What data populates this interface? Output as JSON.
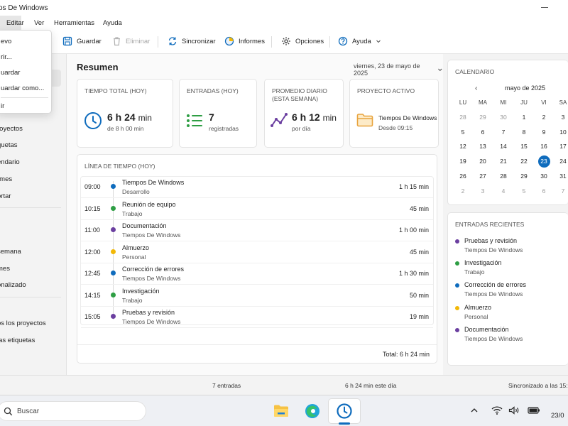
{
  "window": {
    "title": "os De Windows"
  },
  "menubar": {
    "items": [
      "",
      "Editar",
      "Ver",
      "Herramientas",
      "Ayuda"
    ]
  },
  "toolbar": {
    "save": "Guardar",
    "delete": "Eliminar",
    "sync": "Sincronizar",
    "reports": "Informes",
    "options": "Opciones",
    "help": "Ayuda"
  },
  "file_menu": {
    "items": [
      "evo",
      "rir...",
      "uardar",
      "uardar como...",
      "ir"
    ]
  },
  "sidebar": {
    "items": [
      "royectos",
      "quetas",
      "endario",
      "rmes",
      "ortar"
    ],
    "section2": [
      "semana",
      "mes",
      "onalizado"
    ],
    "section3": [
      "os los proyectos",
      "las etiquetas"
    ]
  },
  "main": {
    "heading": "Resumen",
    "date": "viernes, 23 de mayo de 2025",
    "cards": [
      {
        "title": "TIEMPO TOTAL (HOY)",
        "value": "6 h 24",
        "unit": "min",
        "sub": "de 8 h 00 min"
      },
      {
        "title": "ENTRADAS (HOY)",
        "value": "7",
        "unit": "",
        "sub": "registradas"
      },
      {
        "title": "PROMEDIO DIARIO (ESTA SEMANA)",
        "value": "6 h 12",
        "unit": "min",
        "sub": "por día"
      },
      {
        "title": "PROYECTO ACTIVO",
        "value": "Tiempos De Windows",
        "unit": "",
        "sub": "Desde 09:15"
      }
    ],
    "timeline": {
      "title": "LÍNEA DE TIEMPO (HOY)",
      "total": "Total: 6 h 24 min",
      "rows": [
        {
          "time": "09:00",
          "name": "Tiempos De Windows",
          "project": "Desarrollo",
          "duration": "1 h 15 min",
          "color": "#0f6cbd"
        },
        {
          "time": "10:15",
          "name": "Reunión de equipo",
          "project": "Trabajo",
          "duration": "45 min",
          "color": "#2e9e44"
        },
        {
          "time": "11:00",
          "name": "Documentación",
          "project": "Tiempos De Windows",
          "duration": "1 h 00 min",
          "color": "#6b3fa0"
        },
        {
          "time": "12:00",
          "name": "Almuerzo",
          "project": "Personal",
          "duration": "45 min",
          "color": "#f2b807"
        },
        {
          "time": "12:45",
          "name": "Corrección de errores",
          "project": "Tiempos De Windows",
          "duration": "1 h 30 min",
          "color": "#0f6cbd"
        },
        {
          "time": "14:15",
          "name": "Investigación",
          "project": "Trabajo",
          "duration": "50 min",
          "color": "#2e9e44"
        },
        {
          "time": "15:05",
          "name": "Pruebas y revisión",
          "project": "Tiempos De Windows",
          "duration": "19 min",
          "color": "#6b3fa0"
        }
      ]
    }
  },
  "calendar": {
    "title": "CALENDARIO",
    "month": "mayo de 2025",
    "prev": "‹",
    "weekdays": [
      "LU",
      "MA",
      "MI",
      "JU",
      "VI",
      "SA"
    ],
    "weeks": [
      [
        "28",
        "29",
        "30",
        "1",
        "2",
        "3"
      ],
      [
        "5",
        "6",
        "7",
        "8",
        "9",
        "10"
      ],
      [
        "12",
        "13",
        "14",
        "15",
        "16",
        "17"
      ],
      [
        "19",
        "20",
        "21",
        "22",
        "23",
        "24"
      ],
      [
        "26",
        "27",
        "28",
        "29",
        "30",
        "31"
      ],
      [
        "2",
        "3",
        "4",
        "5",
        "6",
        "7"
      ]
    ],
    "today": "23"
  },
  "recent": {
    "title": "ENTRADAS RECIENTES",
    "items": [
      {
        "name": "Pruebas y revisión",
        "project": "Tiempos De Windows",
        "color": "#6b3fa0"
      },
      {
        "name": "Investigación",
        "project": "Trabajo",
        "color": "#2e9e44"
      },
      {
        "name": "Corrección de errores",
        "project": "Tiempos De Windows",
        "color": "#0f6cbd"
      },
      {
        "name": "Almuerzo",
        "project": "Personal",
        "color": "#f2b807"
      },
      {
        "name": "Documentación",
        "project": "Tiempos De Windows",
        "color": "#6b3fa0"
      }
    ]
  },
  "statusbar": {
    "entries": "7 entradas",
    "week": "6 h 24 min este día",
    "sync": "Sincronizado a las 15:2"
  },
  "taskbar": {
    "search": "Buscar",
    "date": "23/0"
  },
  "colors": {
    "accent": "#0f6cbd",
    "green": "#2e9e44",
    "purple": "#6b3fa0",
    "yellow": "#f2b807",
    "folder": "#e8a33d"
  }
}
